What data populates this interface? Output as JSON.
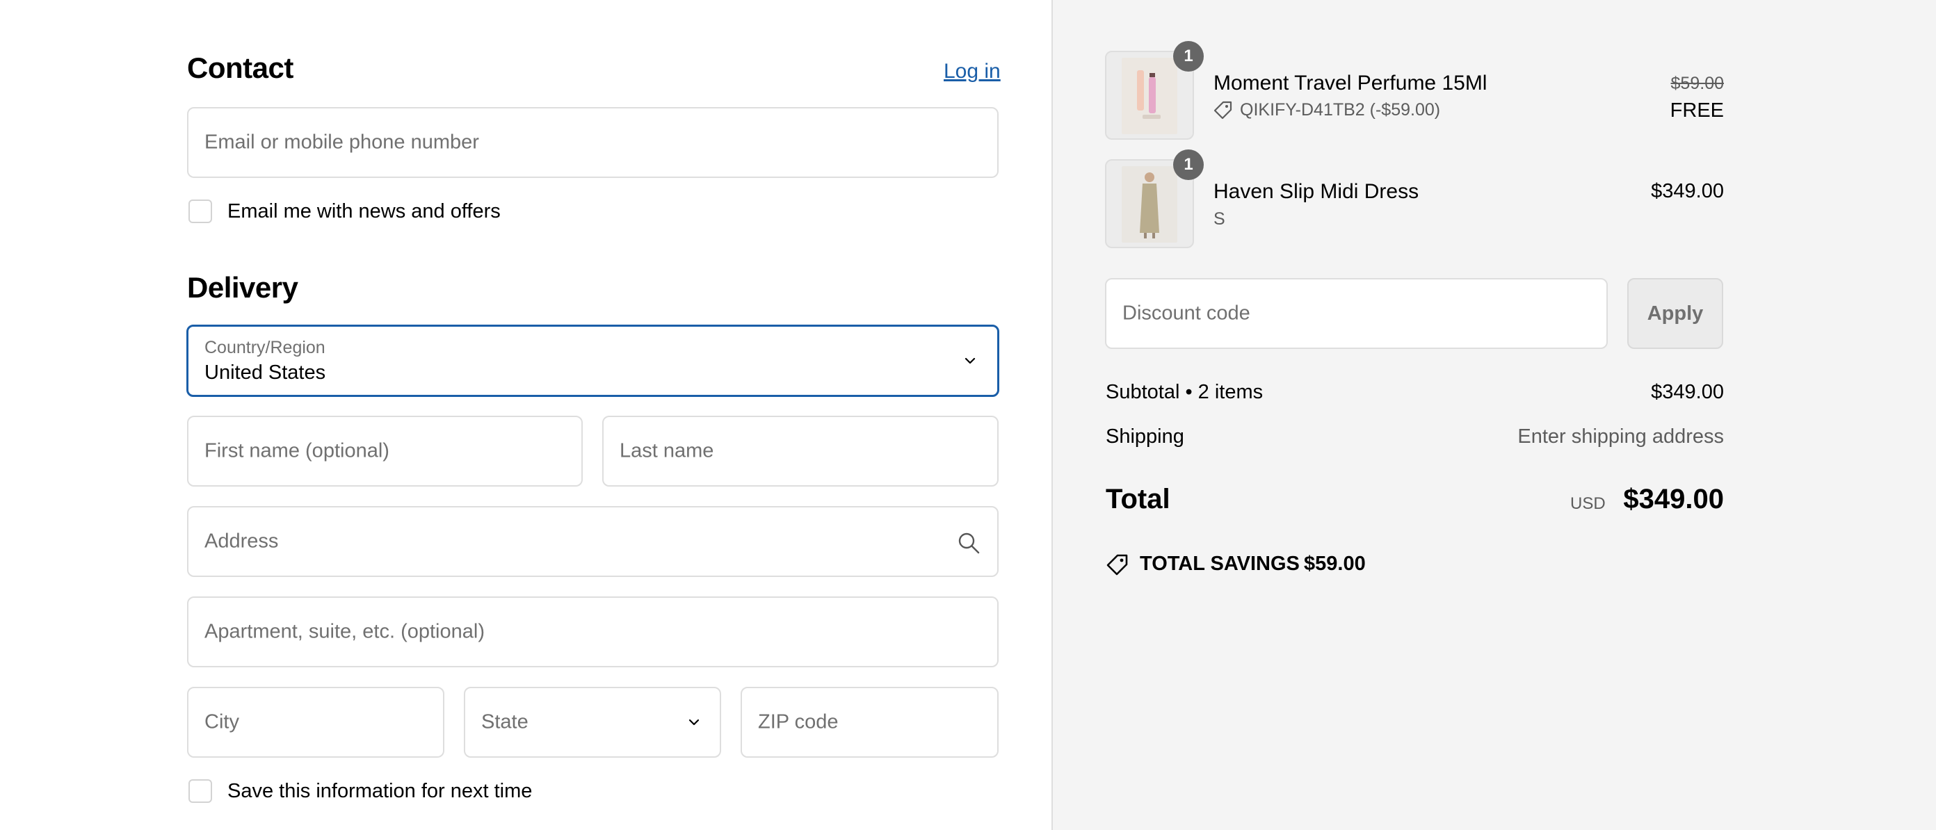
{
  "contact": {
    "title": "Contact",
    "login_link": "Log in",
    "email_placeholder": "Email or mobile phone number",
    "news_checkbox_label": "Email me with news and offers"
  },
  "delivery": {
    "title": "Delivery",
    "country_label": "Country/Region",
    "country_value": "United States",
    "first_name_placeholder": "First name (optional)",
    "last_name_placeholder": "Last name",
    "address_placeholder": "Address",
    "apartment_placeholder": "Apartment, suite, etc. (optional)",
    "city_placeholder": "City",
    "state_placeholder": "State",
    "zip_placeholder": "ZIP code",
    "save_checkbox_label": "Save this information for next time"
  },
  "cart": {
    "items": [
      {
        "quantity": "1",
        "name": "Moment Travel Perfume 15Ml",
        "discount": "QIKIFY-D41TB2 (-$59.00)",
        "original_price": "$59.00",
        "price": "FREE"
      },
      {
        "quantity": "1",
        "name": "Haven Slip Midi Dress",
        "variant": "S",
        "price": "$349.00"
      }
    ],
    "discount_placeholder": "Discount code",
    "apply_label": "Apply",
    "subtotal_label": "Subtotal • 2 items",
    "subtotal_value": "$349.00",
    "shipping_label": "Shipping",
    "shipping_value": "Enter shipping address",
    "total_label": "Total",
    "total_currency": "USD",
    "total_value": "$349.00",
    "savings_label": "TOTAL SAVINGS",
    "savings_value": "$59.00"
  },
  "icons": {
    "select_arrow": "chevron-down-icon",
    "address_search": "search-icon",
    "discount_tag": "tag-icon"
  },
  "colors": {
    "accent": "#1a5ea8",
    "summary_background": "#f4f4f4",
    "badge": "#666666"
  }
}
